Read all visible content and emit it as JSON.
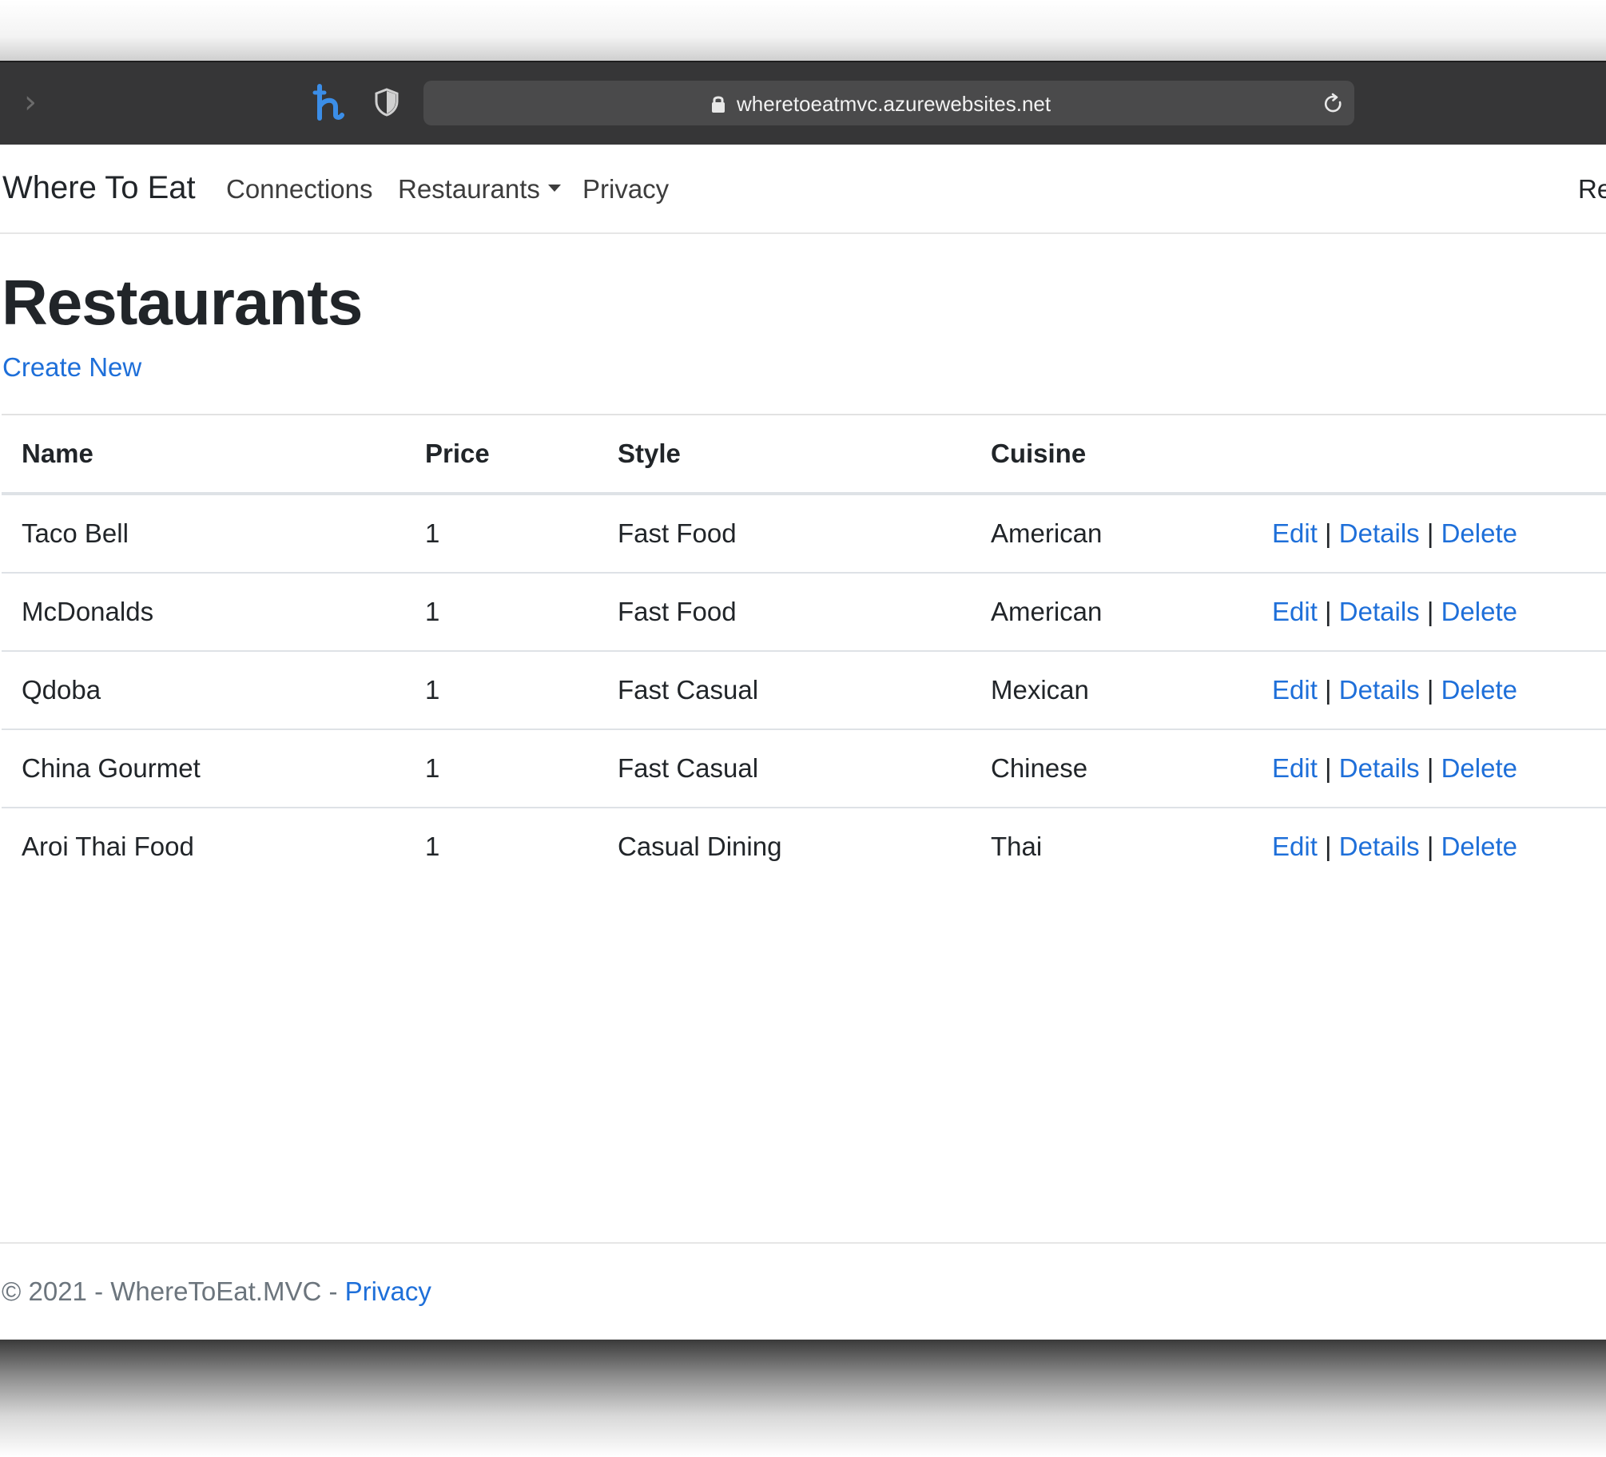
{
  "browser": {
    "url": "wheretoeatmvc.azurewebsites.net",
    "forward_glyph": "›",
    "icons": [
      "chevron-right-icon",
      "honey-extension-icon",
      "shield-icon",
      "lock-icon",
      "reload-icon"
    ]
  },
  "navbar": {
    "brand": "Where To Eat",
    "links": {
      "connections": "Connections",
      "restaurants": "Restaurants",
      "privacy": "Privacy"
    },
    "right_cut": "Re"
  },
  "page": {
    "title": "Restaurants",
    "create_new": "Create New"
  },
  "table": {
    "headers": [
      "Name",
      "Price",
      "Style",
      "Cuisine"
    ],
    "action_labels": {
      "edit": "Edit",
      "details": "Details",
      "delete": "Delete",
      "separator": "|"
    },
    "rows": [
      {
        "name": "Taco Bell",
        "price": "1",
        "style": "Fast Food",
        "cuisine": "American"
      },
      {
        "name": "McDonalds",
        "price": "1",
        "style": "Fast Food",
        "cuisine": "American"
      },
      {
        "name": "Qdoba",
        "price": "1",
        "style": "Fast Casual",
        "cuisine": "Mexican"
      },
      {
        "name": "China Gourmet",
        "price": "1",
        "style": "Fast Casual",
        "cuisine": "Chinese"
      },
      {
        "name": "Aroi Thai Food",
        "price": "1",
        "style": "Casual Dining",
        "cuisine": "Thai"
      }
    ]
  },
  "footer": {
    "text": "© 2021 - WhereToEat.MVC - ",
    "privacy": "Privacy"
  },
  "colors": {
    "toolbar": "#363637",
    "address_bar": "#4a4a4b",
    "link": "#1e6fd9",
    "text": "#212529",
    "muted": "#6c757d",
    "extension_icon": "#3b8ee8"
  }
}
